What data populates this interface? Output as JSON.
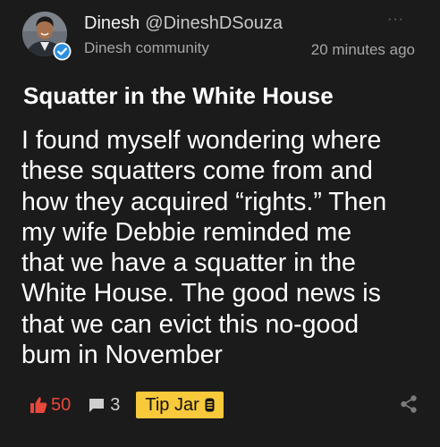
{
  "author": {
    "name": "Dinesh",
    "handle": "@DineshDSouza",
    "community": "Dinesh community",
    "timestamp": "20 minutes ago",
    "verified": true
  },
  "post": {
    "title": "Squatter in the White House",
    "body_lines": [
      "I found myself wondering where",
      "these squatters come from and",
      "how they acquired “rights.” Then",
      "my wife Debbie reminded me",
      "that we have a squatter in the",
      "White House. The good news is",
      "that we can evict this no-good",
      "bum in November"
    ]
  },
  "actions": {
    "like_count": "50",
    "comment_count": "3",
    "tipjar_label": "Tip Jar"
  },
  "colors": {
    "background": "#1b1b1b",
    "like": "#e8473b",
    "tipjar": "#f7c93b",
    "verified": "#2b8fe0",
    "muted": "#a6a6a6"
  },
  "icons": {
    "more": "more-icon",
    "verified": "verified-badge-icon",
    "like": "thumbs-up-icon",
    "comment": "comment-icon",
    "tipjar": "coin-jar-icon",
    "share": "share-icon"
  }
}
